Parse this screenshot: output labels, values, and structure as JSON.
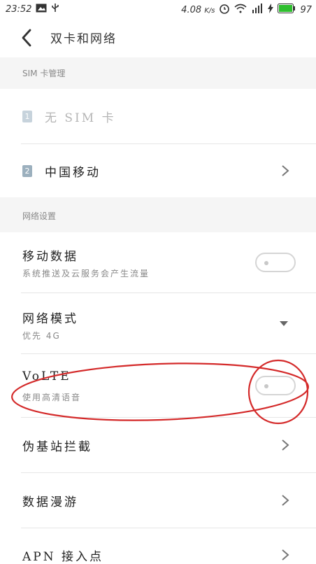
{
  "statusbar": {
    "time": "23:52",
    "speed": "4.08",
    "speed_unit": "K/s",
    "battery": "97"
  },
  "toolbar": {
    "title": "双卡和网络"
  },
  "sim_section": {
    "header": "SIM 卡管理",
    "sim1": {
      "badge": "1",
      "label": "无 SIM 卡"
    },
    "sim2": {
      "badge": "2",
      "label": "中国移动"
    }
  },
  "network_section": {
    "header": "网络设置",
    "mobile_data": {
      "label": "移动数据",
      "sub": "系统推送及云服务会产生流量",
      "enabled": false
    },
    "network_mode": {
      "label": "网络模式",
      "sub": "优先 4G"
    },
    "volte": {
      "label": "VoLTE",
      "sub": "使用高清语音",
      "enabled": false
    },
    "fake_station": {
      "label": "伪基站拦截"
    },
    "roaming": {
      "label": "数据漫游"
    },
    "apn": {
      "label": "APN 接入点"
    }
  },
  "colors": {
    "annotation": "#d42a2a",
    "section_bg": "#f5f5f5",
    "battery": "#2fbf2f"
  }
}
